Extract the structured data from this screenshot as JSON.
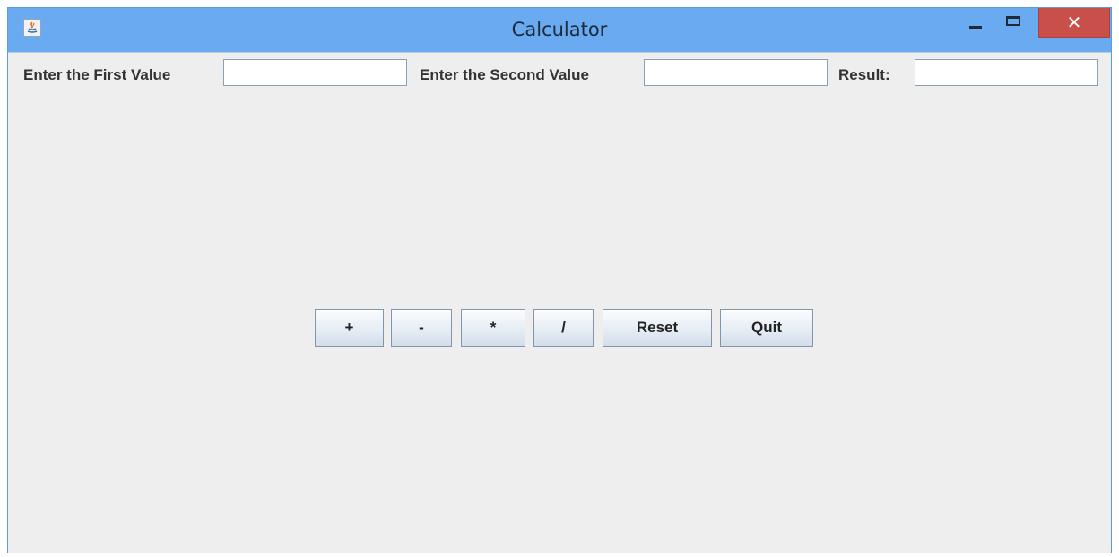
{
  "window": {
    "title": "Calculator",
    "close_glyph": "✕",
    "icons": {
      "app": "java-app-icon",
      "minimize": "minimize-icon",
      "maximize": "maximize-icon",
      "close": "close-icon"
    },
    "close_color": "#c9504a",
    "titlebar_color": "#6aaaf0"
  },
  "inputs": {
    "first_label": "Enter the First Value",
    "first_value": "",
    "second_label": "Enter the Second Value",
    "second_value": "",
    "result_label": "Result:",
    "result_value": ""
  },
  "buttons": {
    "add": "+",
    "subtract": "-",
    "multiply": "*",
    "divide": "/",
    "reset": "Reset",
    "quit": "Quit"
  }
}
